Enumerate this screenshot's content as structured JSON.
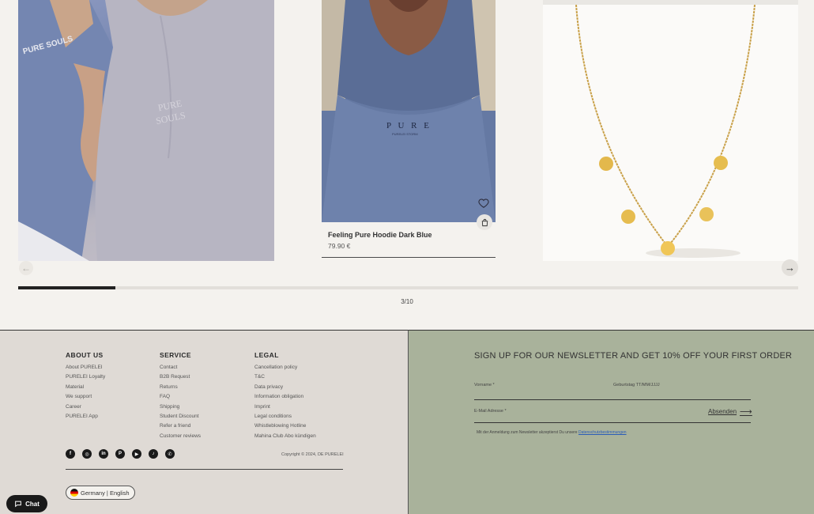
{
  "carousel": {
    "product": {
      "title": "Feeling Pure Hoodie Dark Blue",
      "price": "79.90 €"
    },
    "pager": "3/10",
    "progress_fraction": 0.125,
    "arrow_prev": "←",
    "arrow_next": "→",
    "tshirt_print": "PURE SOULS",
    "tshirt_print_small": "PURE\nSOULS",
    "hoodie_print": "P U R E",
    "hoodie_print_small": "PURELEI STORM"
  },
  "footer": {
    "about": {
      "heading": "ABOUT US",
      "links": [
        "About PURELEI",
        "PURELEI Loyalty",
        "Material",
        "We support",
        "Career",
        "PURELEI App"
      ]
    },
    "service": {
      "heading": "SERVICE",
      "links": [
        "Contact",
        "B2B Request",
        "Returns",
        "FAQ",
        "Shipping",
        "Student Discount",
        "Refer a friend",
        "Customer reviews"
      ]
    },
    "legal": {
      "heading": "LEGAL",
      "links": [
        "Cancellation policy",
        "T&C",
        "Data privacy",
        "Information obligation",
        "Imprint",
        "Legal conditions",
        "Whistleblowing Hotline",
        "Mahina Club Abo kündigen"
      ]
    },
    "socials": [
      "facebook-icon",
      "instagram-icon",
      "linkedin-icon",
      "pinterest-icon",
      "youtube-icon",
      "tiktok-icon",
      "whatsapp-icon"
    ],
    "copyright": "Copyright © 2024, DE PURELEI",
    "language": "Germany | English"
  },
  "newsletter": {
    "title": "SIGN UP FOR OUR NEWSLETTER AND GET 10% OFF YOUR FIRST ORDER",
    "first_name_label": "Vorname *",
    "birthday_label": "Geburtstag TT/MM/JJJJ",
    "email_label": "E-Mail Adresse *",
    "submit": "Absenden",
    "note": "Mit der Anmeldung zum Newsletter akzeptierst Du unsere ",
    "note_link": "Datenschutzbestimmungen"
  },
  "chat": {
    "label": "Chat"
  }
}
